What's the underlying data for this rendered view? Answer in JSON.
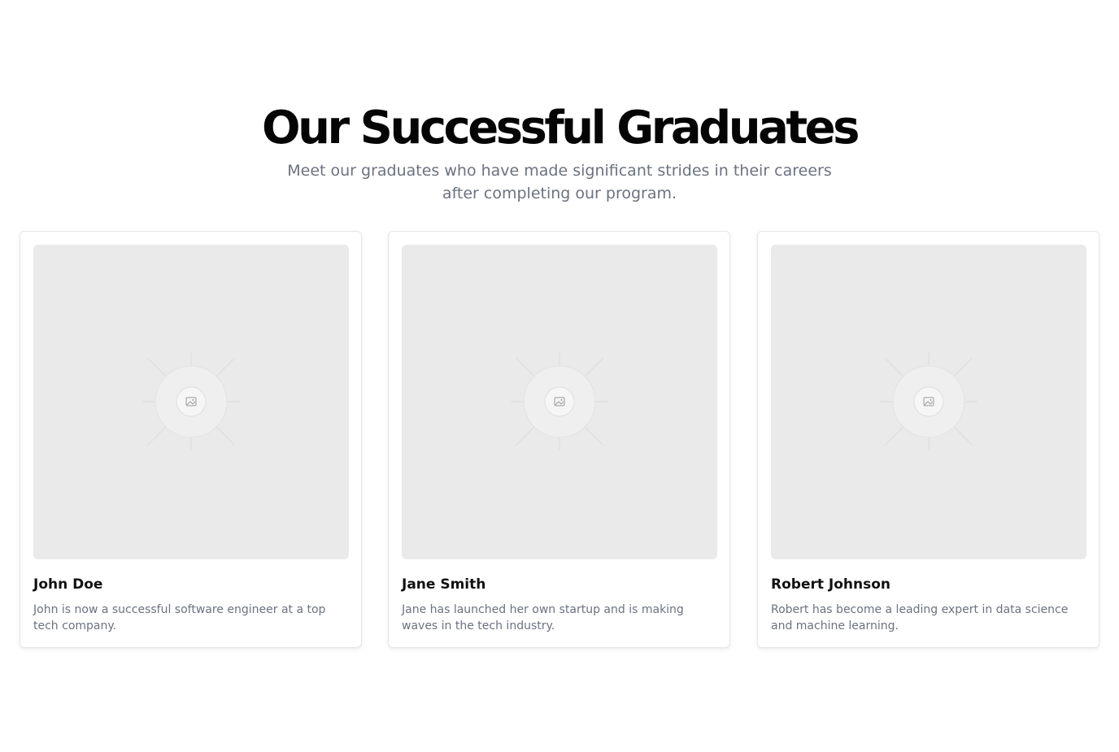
{
  "section": {
    "title": "Our Successful Graduates",
    "subtitle": "Meet our graduates who have made significant strides in their careers after completing our program."
  },
  "graduates": [
    {
      "name": "John Doe",
      "description": "John is now a successful software engineer at a top tech company.",
      "image_icon": "image-placeholder-icon"
    },
    {
      "name": "Jane Smith",
      "description": "Jane has launched her own startup and is making waves in the tech industry.",
      "image_icon": "image-placeholder-icon"
    },
    {
      "name": "Robert Johnson",
      "description": "Robert has become a leading expert in data science and machine learning.",
      "image_icon": "image-placeholder-icon"
    }
  ],
  "colors": {
    "heading": "#050505",
    "muted_text": "#6b7280",
    "placeholder_bg": "#eaeaea",
    "card_border": "#e5e7eb"
  }
}
